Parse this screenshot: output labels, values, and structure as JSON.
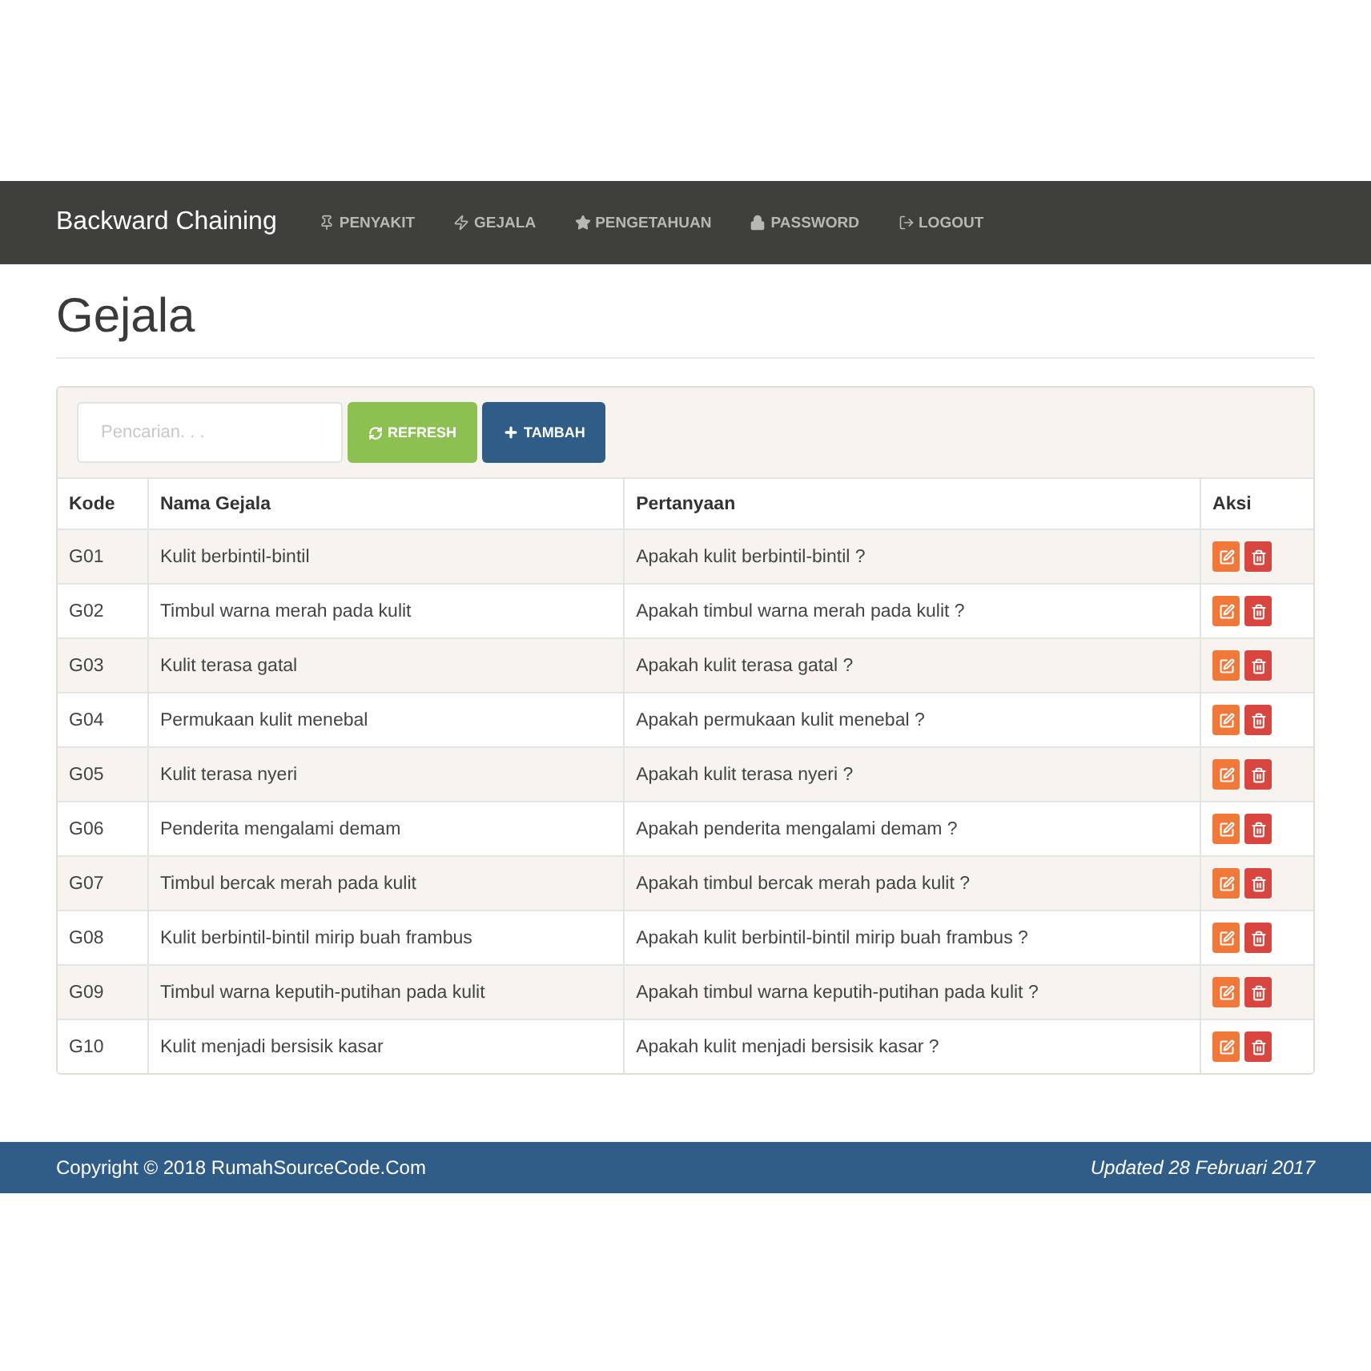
{
  "navbar": {
    "brand": "Backward Chaining",
    "items": [
      {
        "label": "PENYAKIT",
        "selected": false
      },
      {
        "label": "GEJALA",
        "selected": false
      },
      {
        "label": "PENGETAHUAN",
        "selected": false
      },
      {
        "label": "PASSWORD",
        "selected": false
      },
      {
        "label": "LOGOUT",
        "selected": false
      }
    ]
  },
  "page_title": "Gejala",
  "toolbar": {
    "search": {
      "placeholder": "Pencarian. . ."
    },
    "refresh_button": "REFRESH",
    "add_button": "TAMBAH"
  },
  "table": {
    "columns": [
      "Kode",
      "Nama Gejala",
      "Pertanyaan",
      "Aksi"
    ],
    "rows": [
      {
        "kode": "G01",
        "nama": "Kulit berbintil-bintil",
        "pertanyaan": "Apakah kulit berbintil-bintil ?"
      },
      {
        "kode": "G02",
        "nama": "Timbul warna merah pada kulit",
        "pertanyaan": "Apakah timbul warna merah pada kulit ?"
      },
      {
        "kode": "G03",
        "nama": "Kulit terasa gatal",
        "pertanyaan": "Apakah kulit terasa gatal ?"
      },
      {
        "kode": "G04",
        "nama": "Permukaan kulit menebal",
        "pertanyaan": "Apakah permukaan kulit menebal ?"
      },
      {
        "kode": "G05",
        "nama": "Kulit terasa nyeri",
        "pertanyaan": "Apakah kulit terasa nyeri ?"
      },
      {
        "kode": "G06",
        "nama": "Penderita mengalami demam",
        "pertanyaan": "Apakah penderita mengalami demam ?"
      },
      {
        "kode": "G07",
        "nama": "Timbul bercak merah pada kulit",
        "pertanyaan": "Apakah timbul bercak merah pada kulit ?"
      },
      {
        "kode": "G08",
        "nama": "Kulit berbintil-bintil mirip buah frambus",
        "pertanyaan": "Apakah kulit berbintil-bintil mirip buah frambus ?"
      },
      {
        "kode": "G09",
        "nama": "Timbul warna keputih-putihan pada kulit",
        "pertanyaan": "Apakah timbul warna keputih-putihan pada kulit ?"
      },
      {
        "kode": "G10",
        "nama": "Kulit menjadi bersisik kasar",
        "pertanyaan": "Apakah kulit menjadi bersisik kasar ?"
      }
    ]
  },
  "footer": {
    "copyright": "Copyright © 2018 RumahSourceCode.Com",
    "updated": "Updated 28 Februari 2017"
  }
}
